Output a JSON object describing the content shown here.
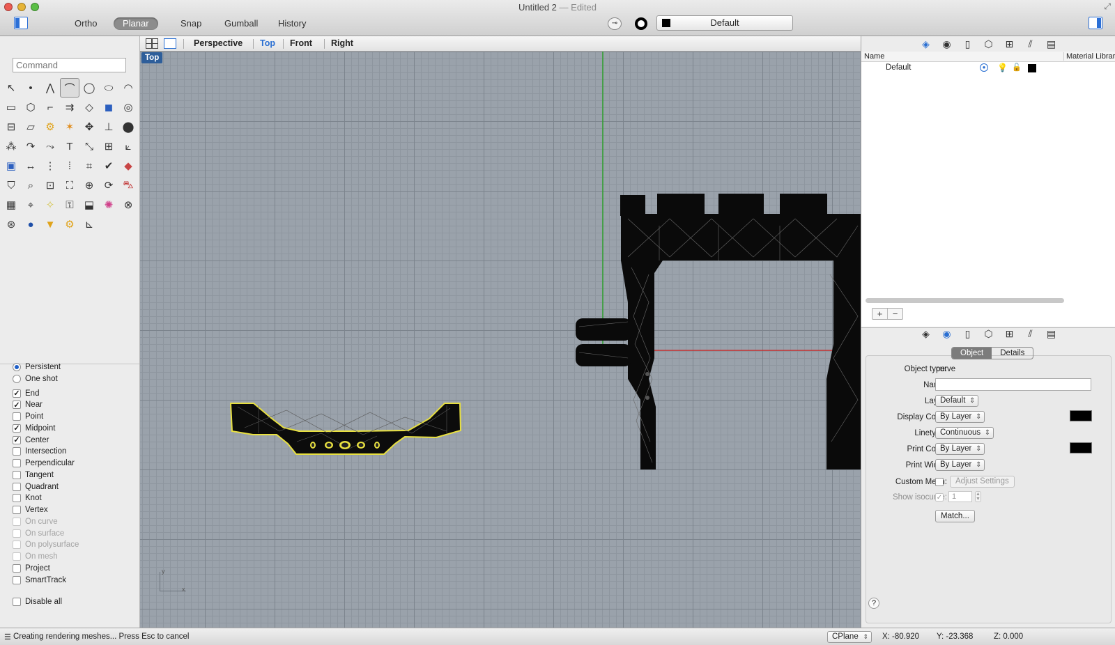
{
  "window": {
    "title": "Untitled 2",
    "subtitle": "— Edited"
  },
  "toolbar": {
    "toggles": [
      {
        "label": "Ortho",
        "on": false
      },
      {
        "label": "Planar",
        "on": true
      },
      {
        "label": "Snap",
        "on": false
      },
      {
        "label": "Gumball",
        "on": false
      },
      {
        "label": "History",
        "on": false
      }
    ],
    "layer_dropdown": "Default"
  },
  "command": {
    "placeholder": "Command"
  },
  "tools": [
    "select-arrow",
    "point",
    "polyline",
    "curve-from-points",
    "circle",
    "ellipse",
    "arc",
    "rectangle",
    "polygon",
    "fillet-curve",
    "offset-curve",
    "surface-from-curves",
    "box",
    "boolean-union",
    "extrude",
    "surface-patch",
    "gear-tool",
    "explode",
    "move-tool",
    "join",
    "solid-tools",
    "group",
    "arc-blend",
    "blend-curve",
    "text",
    "scale",
    "array",
    "transform",
    "solid-box",
    "dimension",
    "grid-array",
    "control-points",
    "analyze",
    "check",
    "shade",
    "paint-bucket",
    "zoom",
    "zoom-window",
    "zoom-extents",
    "target",
    "rotate-view",
    "car-tool",
    "mesh-tool",
    "snap-points",
    "light-bulb",
    "lock",
    "clipping-plane",
    "color-wheel",
    "sphere-display",
    "sphere-wire",
    "render-sphere",
    "spotlight",
    "settings-gear",
    "cplane-axes"
  ],
  "osnaps": {
    "mode": [
      {
        "label": "Persistent",
        "selected": true
      },
      {
        "label": "One shot",
        "selected": false
      }
    ],
    "items": [
      {
        "label": "End",
        "checked": true,
        "enabled": true
      },
      {
        "label": "Near",
        "checked": true,
        "enabled": true
      },
      {
        "label": "Point",
        "checked": false,
        "enabled": true
      },
      {
        "label": "Midpoint",
        "checked": true,
        "enabled": true
      },
      {
        "label": "Center",
        "checked": true,
        "enabled": true
      },
      {
        "label": "Intersection",
        "checked": false,
        "enabled": true
      },
      {
        "label": "Perpendicular",
        "checked": false,
        "enabled": true
      },
      {
        "label": "Tangent",
        "checked": false,
        "enabled": true
      },
      {
        "label": "Quadrant",
        "checked": false,
        "enabled": true
      },
      {
        "label": "Knot",
        "checked": false,
        "enabled": true
      },
      {
        "label": "Vertex",
        "checked": false,
        "enabled": true
      },
      {
        "label": "On curve",
        "checked": false,
        "enabled": false
      },
      {
        "label": "On surface",
        "checked": false,
        "enabled": false
      },
      {
        "label": "On polysurface",
        "checked": false,
        "enabled": false
      },
      {
        "label": "On mesh",
        "checked": false,
        "enabled": false
      },
      {
        "label": "Project",
        "checked": false,
        "enabled": true
      },
      {
        "label": "SmartTrack",
        "checked": false,
        "enabled": true
      }
    ],
    "disable_all": "Disable all"
  },
  "viewport_tabs": [
    "Perspective",
    "Top",
    "Front",
    "Right"
  ],
  "active_viewport": "Top",
  "viewport": {
    "label": "Top",
    "axis_y": "y",
    "axis_x": "x"
  },
  "layers": {
    "columns": {
      "name": "Name",
      "material": "Material Library"
    },
    "rows": [
      {
        "name": "Default",
        "color": "#000000"
      }
    ],
    "add": "+",
    "remove": "−"
  },
  "properties": {
    "tabs": [
      "Object",
      "Details"
    ],
    "active_tab": "Object",
    "object_type_label": "Object type:",
    "object_type": "curve",
    "name_label": "Name:",
    "name_value": "",
    "layer_label": "Layer:",
    "layer": "Default",
    "display_color_label": "Display Color:",
    "display_color": "By Layer",
    "linetype_label": "Linetype:",
    "linetype": "Continuous",
    "print_color_label": "Print Color:",
    "print_color": "By Layer",
    "print_width_label": "Print Width:",
    "print_width": "By Layer",
    "custom_mesh_label": "Custom Mesh:",
    "adjust_settings": "Adjust Settings",
    "show_isocurve_label": "Show isocurve:",
    "isocurve_count": "1",
    "match": "Match...",
    "help": "?"
  },
  "status": {
    "message": "Creating rendering meshes... Press Esc to cancel",
    "cplane": "CPlane",
    "x": "X: -80.920",
    "y": "Y: -23.368",
    "z": "Z: 0.000"
  },
  "colors": {
    "accent": "#2a6fd2",
    "viewport_bg": "#9aa2ab",
    "selection_outline": "#e8e040",
    "x_axis": "#c43030",
    "y_axis": "#2fa02f"
  }
}
